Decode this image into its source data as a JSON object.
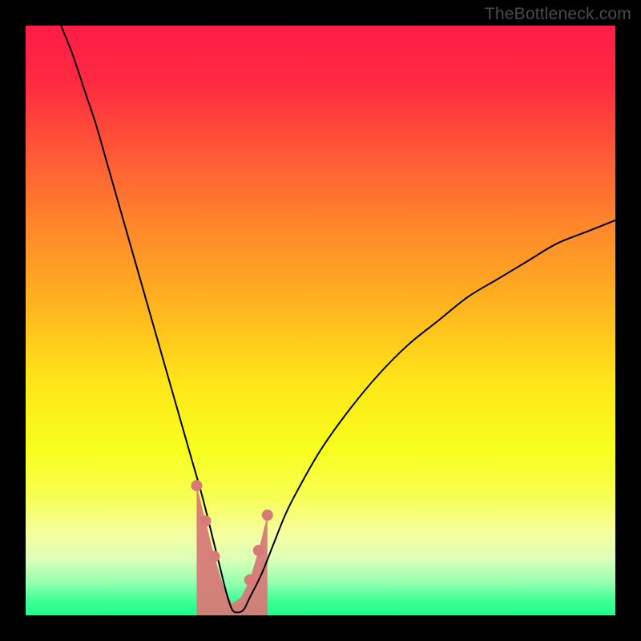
{
  "watermark": {
    "text": "TheBottleneck.com"
  },
  "gradient": {
    "stops": [
      {
        "offset": 0.0,
        "color": "#ff1c47"
      },
      {
        "offset": 0.1,
        "color": "#ff2b42"
      },
      {
        "offset": 0.22,
        "color": "#ff5a36"
      },
      {
        "offset": 0.35,
        "color": "#ff8a2a"
      },
      {
        "offset": 0.48,
        "color": "#ffb61f"
      },
      {
        "offset": 0.6,
        "color": "#ffe419"
      },
      {
        "offset": 0.72,
        "color": "#f7ff1e"
      },
      {
        "offset": 0.8,
        "color": "#f7ff55"
      },
      {
        "offset": 0.86,
        "color": "#f6ffa0"
      },
      {
        "offset": 0.905,
        "color": "#dcffb8"
      },
      {
        "offset": 0.945,
        "color": "#94ffb0"
      },
      {
        "offset": 0.975,
        "color": "#3eff95"
      },
      {
        "offset": 1.0,
        "color": "#1cff8c"
      }
    ]
  },
  "chart_data": {
    "type": "line",
    "title": "",
    "xlabel": "",
    "ylabel": "",
    "xlim": [
      0,
      100
    ],
    "ylim": [
      0,
      100
    ],
    "grid": false,
    "description": "V-shaped bottleneck curve with minimum near x≈35%; overlay shaded band of interest and highlighted points near the trough.",
    "series": [
      {
        "name": "bottleneck-curve",
        "type": "line",
        "stroke": "#000000",
        "x": [
          6,
          8,
          10,
          12,
          14,
          16,
          18,
          20,
          22,
          24,
          26,
          28,
          30,
          32,
          33,
          34,
          35,
          36,
          37,
          38,
          40,
          42,
          44,
          46,
          50,
          55,
          60,
          65,
          70,
          75,
          80,
          85,
          90,
          95,
          100
        ],
        "values": [
          100,
          95,
          89,
          83,
          76,
          69,
          62,
          55,
          48,
          41,
          34,
          27,
          20,
          12,
          8,
          4,
          1,
          0.5,
          1,
          3,
          7,
          12,
          17,
          21,
          28,
          35,
          41,
          46,
          50,
          54,
          57,
          60,
          63,
          65,
          67
        ]
      },
      {
        "name": "marker-band",
        "type": "band",
        "fill": "#d87a78",
        "x": [
          29,
          30.5,
          32,
          33.5,
          35,
          36.5,
          38,
          39.5,
          41
        ],
        "top": [
          22,
          16,
          10,
          5,
          2,
          3,
          6,
          11,
          17
        ],
        "bottom": [
          0,
          0,
          0,
          0,
          0,
          0,
          0,
          0,
          0
        ]
      },
      {
        "name": "marker-points",
        "type": "scatter",
        "fill": "#d87a78",
        "x": [
          29,
          30.5,
          32,
          38,
          39.5,
          41
        ],
        "values": [
          22,
          16,
          10,
          6,
          11,
          17
        ]
      }
    ]
  }
}
